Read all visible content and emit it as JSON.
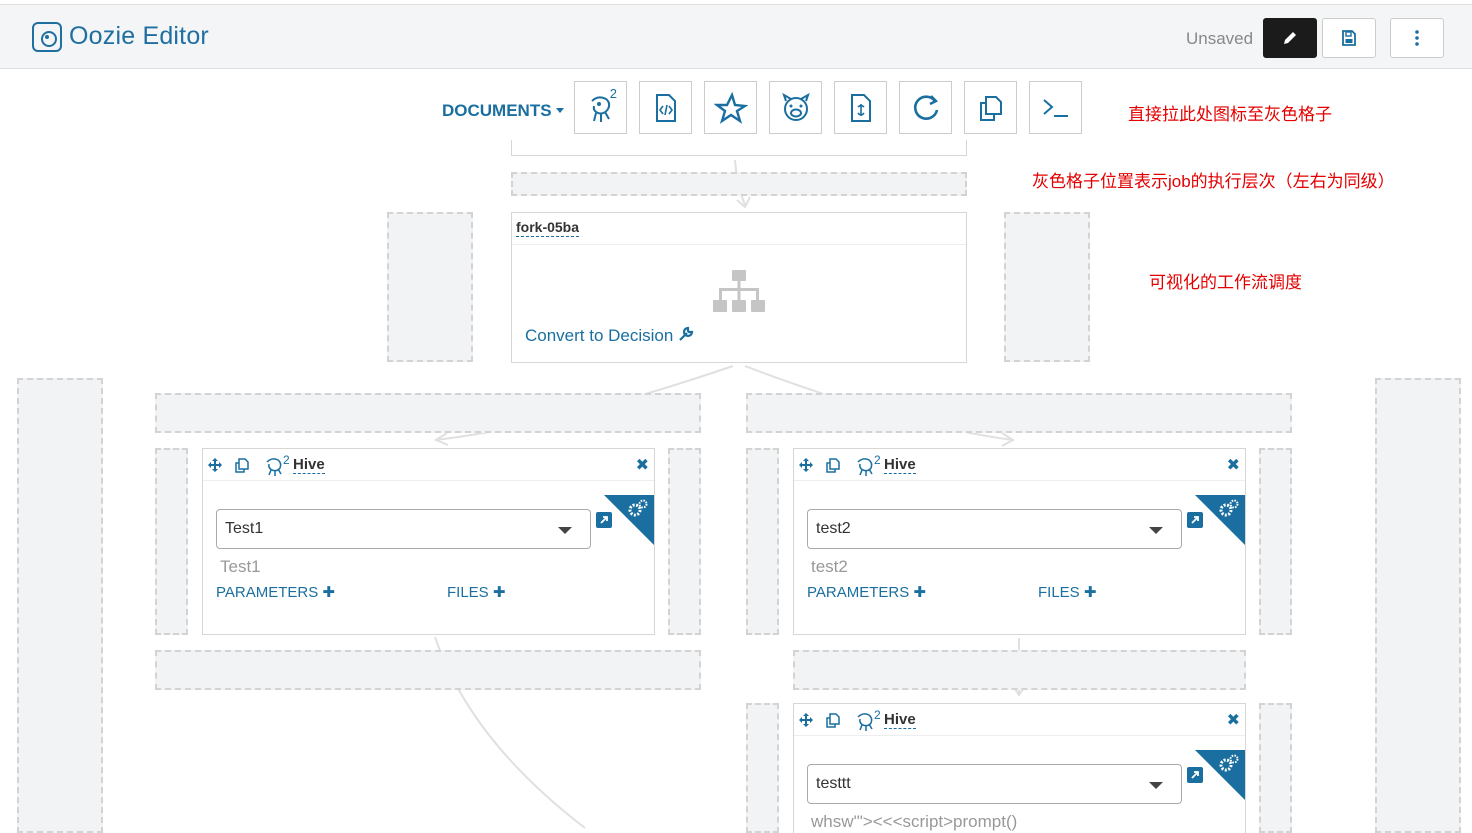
{
  "header": {
    "app_title": "Oozie Editor",
    "status": "Unsaved",
    "edit_icon": "pencil-icon",
    "save_icon": "floppy-disk-icon",
    "more_icon": "vertical-ellipsis-icon"
  },
  "toolbar": {
    "documents_label": "DOCUMENTS",
    "hive_sup": "2",
    "tools": [
      "hive2-icon",
      "code-file-icon",
      "spark-star-icon",
      "pig-icon",
      "shell-file-icon",
      "loop-icon",
      "copy-docs-icon",
      "terminal-icon"
    ]
  },
  "annotations": {
    "drag_hint": "直接拉此处图标至灰色格子",
    "position_hint": "灰色格子位置表示job的执行层次（左右为同级）",
    "visual_hint": "可视化的工作流调度"
  },
  "fork": {
    "name": "fork-05ba",
    "convert_label": "Convert to Decision"
  },
  "hive_nodes": [
    {
      "type_label": "Hive",
      "sup": "2",
      "selected": "Test1",
      "subtitle": "Test1",
      "parameters": "PARAMETERS",
      "files": "FILES"
    },
    {
      "type_label": "Hive",
      "sup": "2",
      "selected": "test2",
      "subtitle": "test2",
      "parameters": "PARAMETERS",
      "files": "FILES"
    },
    {
      "type_label": "Hive",
      "sup": "2",
      "selected": "testtt",
      "subtitle": "whsw'\"><<<script>prompt()"
    }
  ],
  "colors": {
    "accent": "#1a6fa0",
    "annotation": "#e40000",
    "placeholder": "#f2f3f4"
  }
}
